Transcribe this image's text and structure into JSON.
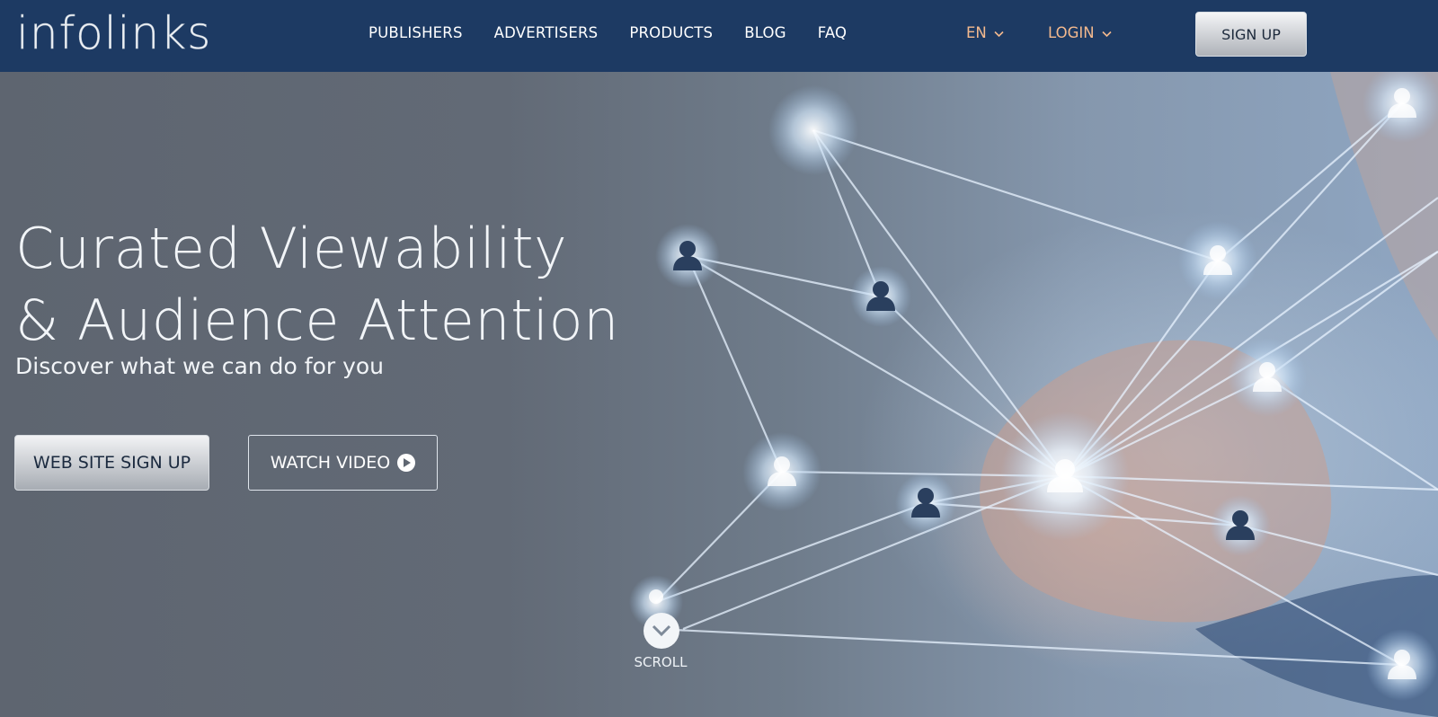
{
  "header": {
    "logo_text": "infolinks",
    "nav": [
      "PUBLISHERS",
      "ADVERTISERS",
      "PRODUCTS",
      "BLOG",
      "FAQ"
    ],
    "language_label": "EN",
    "login_label": "LOGIN",
    "signup_label": "SIGN UP"
  },
  "hero": {
    "title_line1": "Curated Viewability",
    "title_line2": "& Audience Attention",
    "subtitle": "Discover what we can do for you",
    "primary_button": "WEB SITE SIGN UP",
    "video_button": "WATCH VIDEO",
    "scroll_label": "SCROLL"
  },
  "colors": {
    "header_bg": "#1d3a63",
    "dropdown_accent": "#f3b98e",
    "hero_bg": "#5f6772"
  },
  "icons": [
    "chevron-down-icon",
    "play-icon",
    "scroll-down-icon"
  ]
}
